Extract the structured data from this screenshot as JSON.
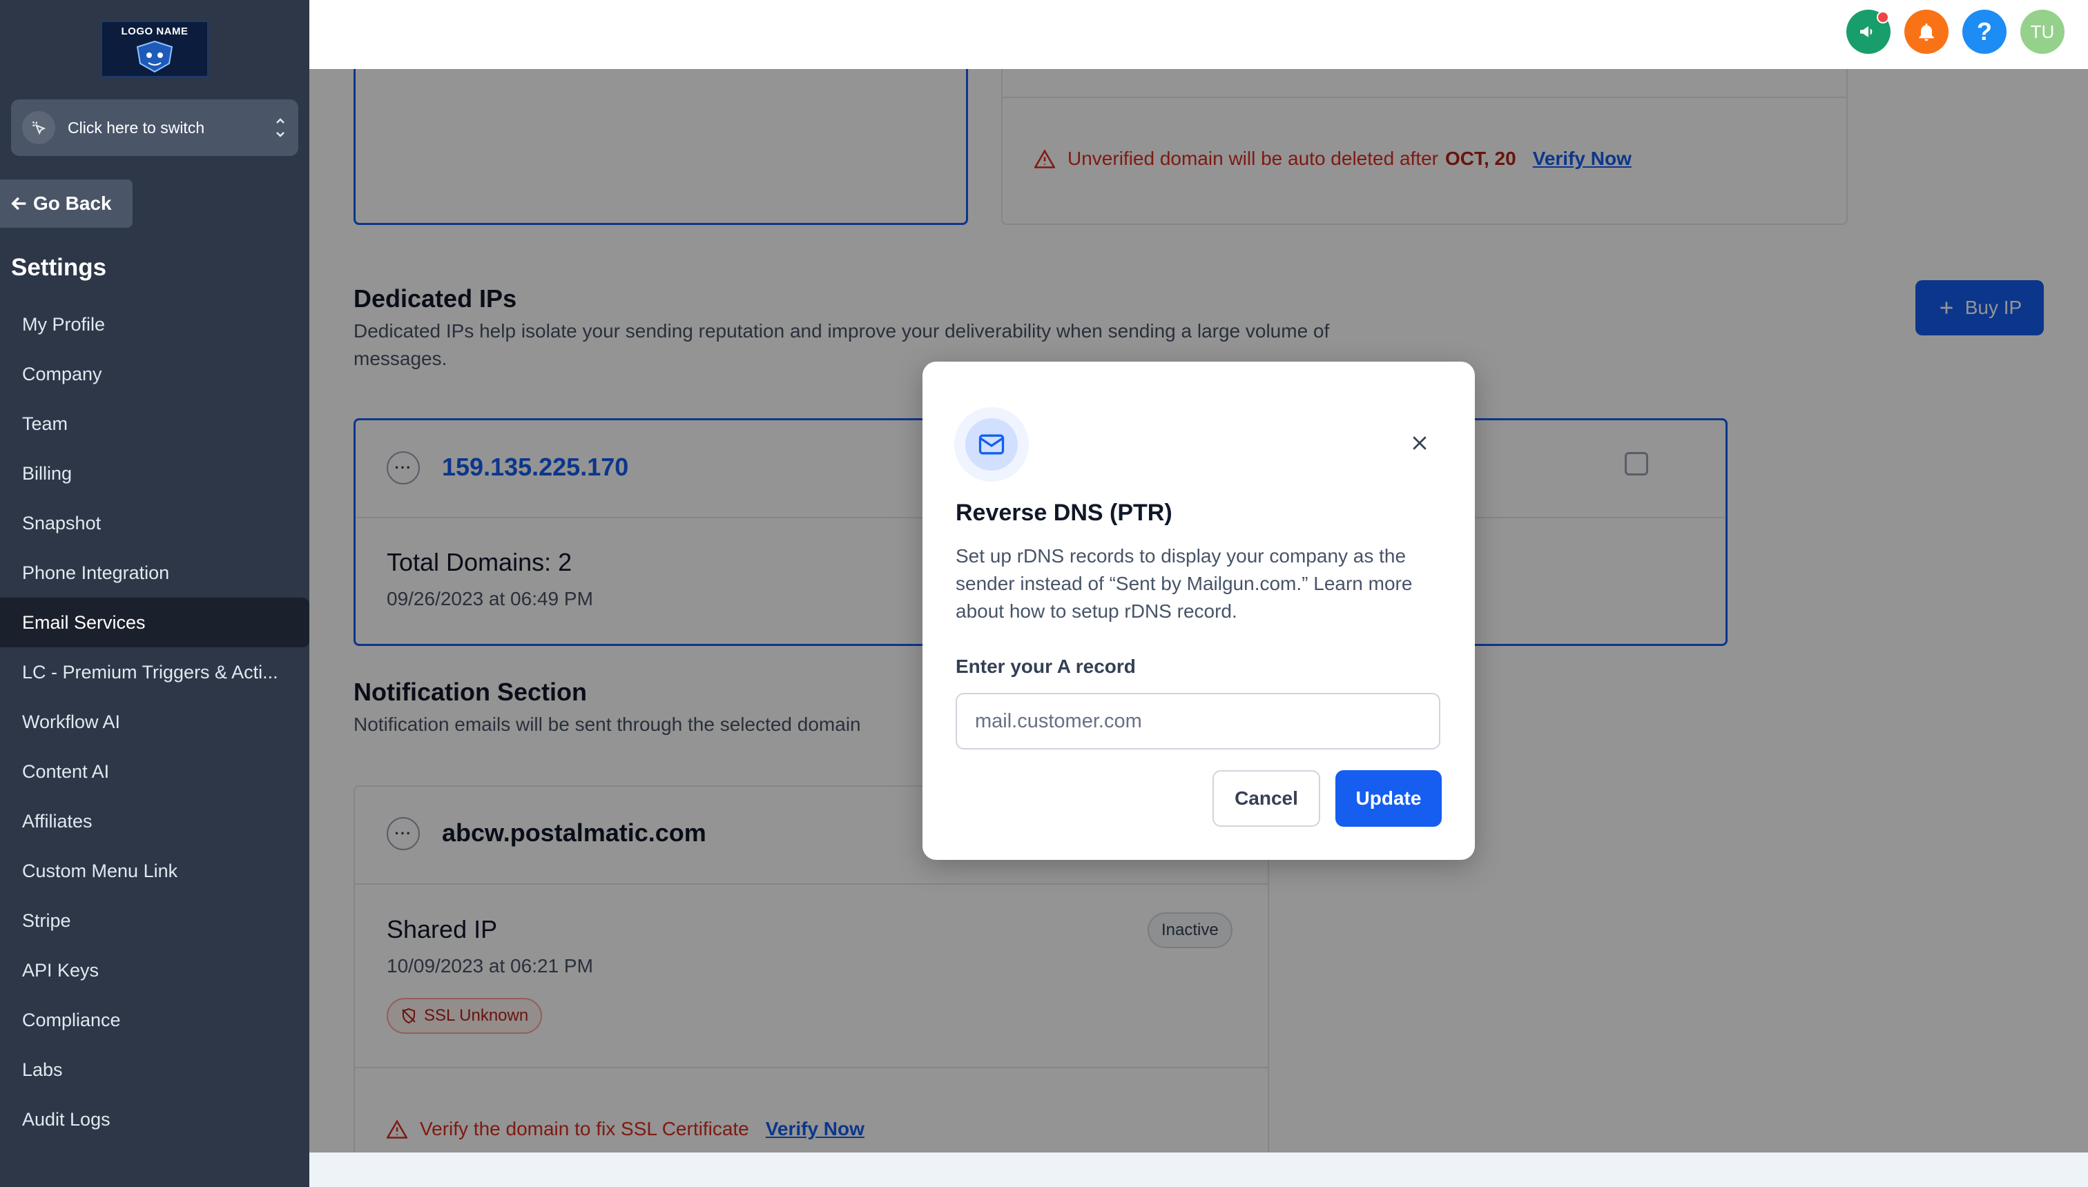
{
  "sidebar": {
    "logo_text": "LOGO NAME",
    "switcher_label": "Click here to switch",
    "go_back": "Go Back",
    "settings_title": "Settings",
    "items": [
      {
        "label": "My Profile"
      },
      {
        "label": "Company"
      },
      {
        "label": "Team"
      },
      {
        "label": "Billing"
      },
      {
        "label": "Snapshot"
      },
      {
        "label": "Phone Integration"
      },
      {
        "label": "Email Services",
        "active": true
      },
      {
        "label": "LC - Premium Triggers & Acti..."
      },
      {
        "label": "Workflow AI"
      },
      {
        "label": "Content AI"
      },
      {
        "label": "Affiliates"
      },
      {
        "label": "Custom Menu Link"
      },
      {
        "label": "Stripe"
      },
      {
        "label": "API Keys"
      },
      {
        "label": "Compliance"
      },
      {
        "label": "Labs"
      },
      {
        "label": "Audit Logs"
      }
    ]
  },
  "topbar": {
    "help_label": "?",
    "avatar_initials": "TU"
  },
  "domain_warning": {
    "text": "Unverified domain will be auto deleted after",
    "date": "OCT, 20",
    "link": "Verify Now"
  },
  "dedicated_ips": {
    "title": "Dedicated IPs",
    "description": "Dedicated IPs help isolate your sending reputation and improve your deliverability when sending a large volume of messages.",
    "buy_button": "Buy IP",
    "card": {
      "menu": "···",
      "ip": "159.135.225.170",
      "total_domains": "Total Domains: 2",
      "date": "09/26/2023 at 06:49 PM"
    }
  },
  "notification": {
    "title": "Notification Section",
    "description": "Notification emails will be sent through the selected domain",
    "card": {
      "menu": "···",
      "domain": "abcw.postalmatic.com",
      "type": "Shared IP",
      "status": "Inactive",
      "date": "10/09/2023 at 06:21 PM",
      "ssl_badge": "SSL Unknown",
      "warning": "Verify the domain to fix SSL Certificate",
      "warning_link": "Verify Now"
    }
  },
  "modal": {
    "title": "Reverse DNS (PTR)",
    "description": "Set up rDNS records to display your company as the sender instead of “Sent by Mailgun.com.” Learn more about how to setup rDNS record.",
    "field_label": "Enter your A record",
    "field_placeholder": "mail.customer.com",
    "cancel": "Cancel",
    "update": "Update"
  },
  "colors": {
    "primary": "#155eef",
    "sidebar_bg": "#2d3748",
    "danger": "#d92d20"
  }
}
